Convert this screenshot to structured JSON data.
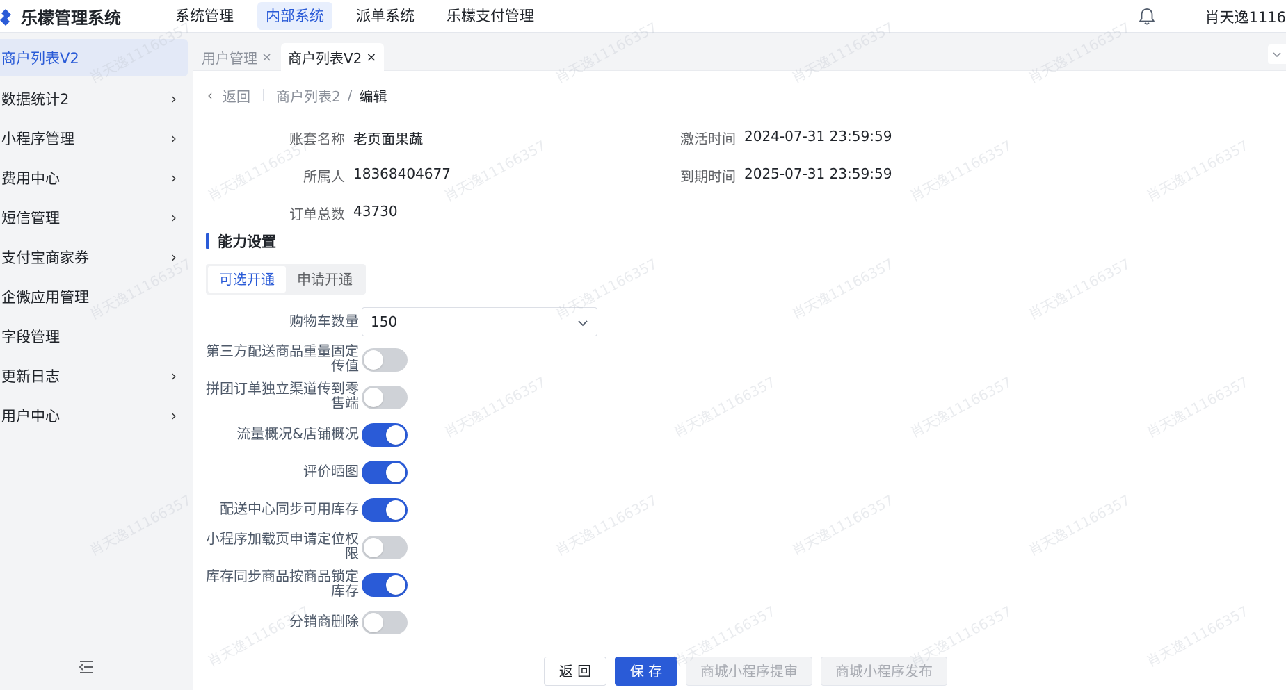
{
  "header": {
    "app_title": "乐檬管理系统",
    "nav": [
      "系统管理",
      "内部系统",
      "派单系统",
      "乐檬支付管理"
    ],
    "active_nav": "内部系统",
    "user": "肖天逸1116"
  },
  "sidebar": {
    "items": [
      {
        "label": "商户列表V2",
        "has_children": false,
        "active": true
      },
      {
        "label": "数据统计2",
        "has_children": true
      },
      {
        "label": "小程序管理",
        "has_children": true
      },
      {
        "label": "费用中心",
        "has_children": true
      },
      {
        "label": "短信管理",
        "has_children": true
      },
      {
        "label": "支付宝商家券",
        "has_children": true
      },
      {
        "label": "企微应用管理",
        "has_children": false
      },
      {
        "label": "字段管理",
        "has_children": false
      },
      {
        "label": "更新日志",
        "has_children": true
      },
      {
        "label": "用户中心",
        "has_children": true
      }
    ],
    "chevron": "›"
  },
  "tabs": [
    {
      "label": "用户管理",
      "close": "×",
      "active": false
    },
    {
      "label": "商户列表V2",
      "close": "×",
      "active": true
    }
  ],
  "breadcrumb": {
    "back_label": "返回",
    "back_arrow": "‹",
    "parent": "商户列表2",
    "separator": "/",
    "current": "编辑"
  },
  "info": {
    "account_name_label": "账套名称",
    "account_name": "老页面果蔬",
    "owner_label": "所属人",
    "owner": "18368404677",
    "order_total_label": "订单总数",
    "order_total": "43730",
    "activation_label": "激活时间",
    "activation": "2024-07-31 23:59:59",
    "expiry_label": "到期时间",
    "expiry": "2025-07-31 23:59:59"
  },
  "capability": {
    "section_title": "能力设置",
    "segments": [
      "可选开通",
      "申请开通"
    ],
    "active_segment": "可选开通",
    "cart_label": "购物车数量",
    "cart_value": "150",
    "switches": [
      {
        "label": "第三方配送商品重量固定传值",
        "on": false
      },
      {
        "label": "拼团订单独立渠道传到零售端",
        "on": false
      },
      {
        "label": "流量概况&店铺概况",
        "on": true
      },
      {
        "label": "评价晒图",
        "on": true
      },
      {
        "label": "配送中心同步可用库存",
        "on": true
      },
      {
        "label": "小程序加载页申请定位权限",
        "on": false
      },
      {
        "label": "库存同步商品按商品锁定库存",
        "on": true
      },
      {
        "label": "分销商删除",
        "on": false
      }
    ]
  },
  "footer": {
    "back": "返 回",
    "save": "保 存",
    "submit_review": "商城小程序提审",
    "publish": "商城小程序发布"
  },
  "watermark": "肖天逸11166357",
  "colors": {
    "accent": "#2a5bd7",
    "switch_off": "#cfd2d7",
    "sidebar_bg": "#f3f4f6",
    "active_nav_bg": "#e8effd"
  }
}
